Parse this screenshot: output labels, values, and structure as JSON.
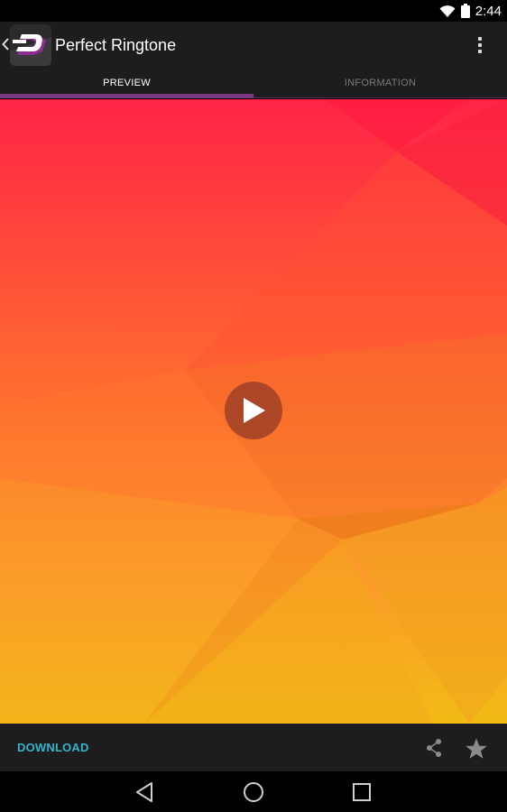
{
  "status_bar": {
    "time": "2:44",
    "icons": [
      "wifi-icon",
      "battery-icon"
    ]
  },
  "action_bar": {
    "title": "Perfect Ringtone",
    "up_icon": "chevron-left-icon",
    "logo_icon": "zedge-logo-icon",
    "overflow_icon": "more-vert-icon"
  },
  "tabs": [
    {
      "label": "PREVIEW",
      "active": true
    },
    {
      "label": "INFORMATION",
      "active": false
    }
  ],
  "preview": {
    "play_icon": "play-icon",
    "colors": {
      "top": "#ff2a45",
      "middle": "#ff7a2e",
      "bottom": "#f4bd14"
    }
  },
  "bottom_bar": {
    "download_label": "DOWNLOAD",
    "download_color": "#35b4c9",
    "share_icon": "share-icon",
    "favorite_icon": "star-icon"
  },
  "nav_bar": {
    "icons": [
      "back-icon",
      "home-icon",
      "recents-icon"
    ]
  }
}
